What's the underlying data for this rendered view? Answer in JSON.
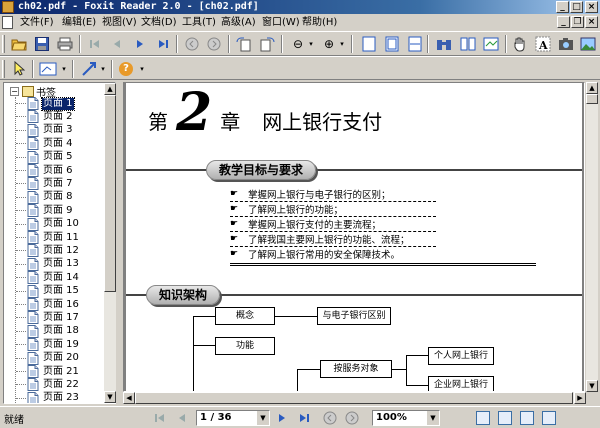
{
  "window": {
    "title": "ch02.pdf - Foxit Reader 2.0 - [ch02.pdf]",
    "buttons": {
      "minimize": "_",
      "maximize": "□",
      "close": "×"
    }
  },
  "menu": {
    "items": [
      "文件(F)",
      "编辑(E)",
      "视图(V)",
      "文档(D)",
      "工具(T)",
      "高级(A)",
      "窗口(W)",
      "帮助(H)"
    ],
    "mdi_buttons": {
      "minimize": "_",
      "restore": "❐",
      "close": "×"
    }
  },
  "toolbar": {
    "zoom_minus": "⊖",
    "zoom_plus": "⊕",
    "dropdown_arrow": "▾",
    "help": "?"
  },
  "bookmarks": {
    "root_label": "书签",
    "toggle": "−",
    "items": [
      "页面 1",
      "页面 2",
      "页面 3",
      "页面 4",
      "页面 5",
      "页面 6",
      "页面 7",
      "页面 8",
      "页面 9",
      "页面 10",
      "页面 11",
      "页面 12",
      "页面 13",
      "页面 14",
      "页面 15",
      "页面 16",
      "页面 17",
      "页面 18",
      "页面 19",
      "页面 20",
      "页面 21",
      "页面 22",
      "页面 23"
    ],
    "selected_index": 0
  },
  "document": {
    "chapter_prefix": "第",
    "chapter_number": "2",
    "chapter_suffix": "章",
    "chapter_name": "网上银行支付",
    "objectives_heading": "教学目标与要求",
    "objectives": [
      "掌握网上银行与电子银行的区别；",
      "了解网上银行的功能；",
      "掌握网上银行支付的主要流程；",
      "了解我国主要网上银行的功能、流程；",
      "了解网上银行常用的安全保障技术。"
    ],
    "bullet": "☛",
    "framework_heading": "知识架构",
    "framework": {
      "concept": "概念",
      "function": "功能",
      "diff": "与电子银行区别",
      "by_service": "按服务对象",
      "personal": "个人网上银行",
      "enterprise": "企业网上银行"
    }
  },
  "statusbar": {
    "status": "就绪",
    "page_field": "1 / 36",
    "zoom_field": "100%"
  },
  "colors": {
    "selection": "#0a246a",
    "titlebar": "#0a246a"
  }
}
